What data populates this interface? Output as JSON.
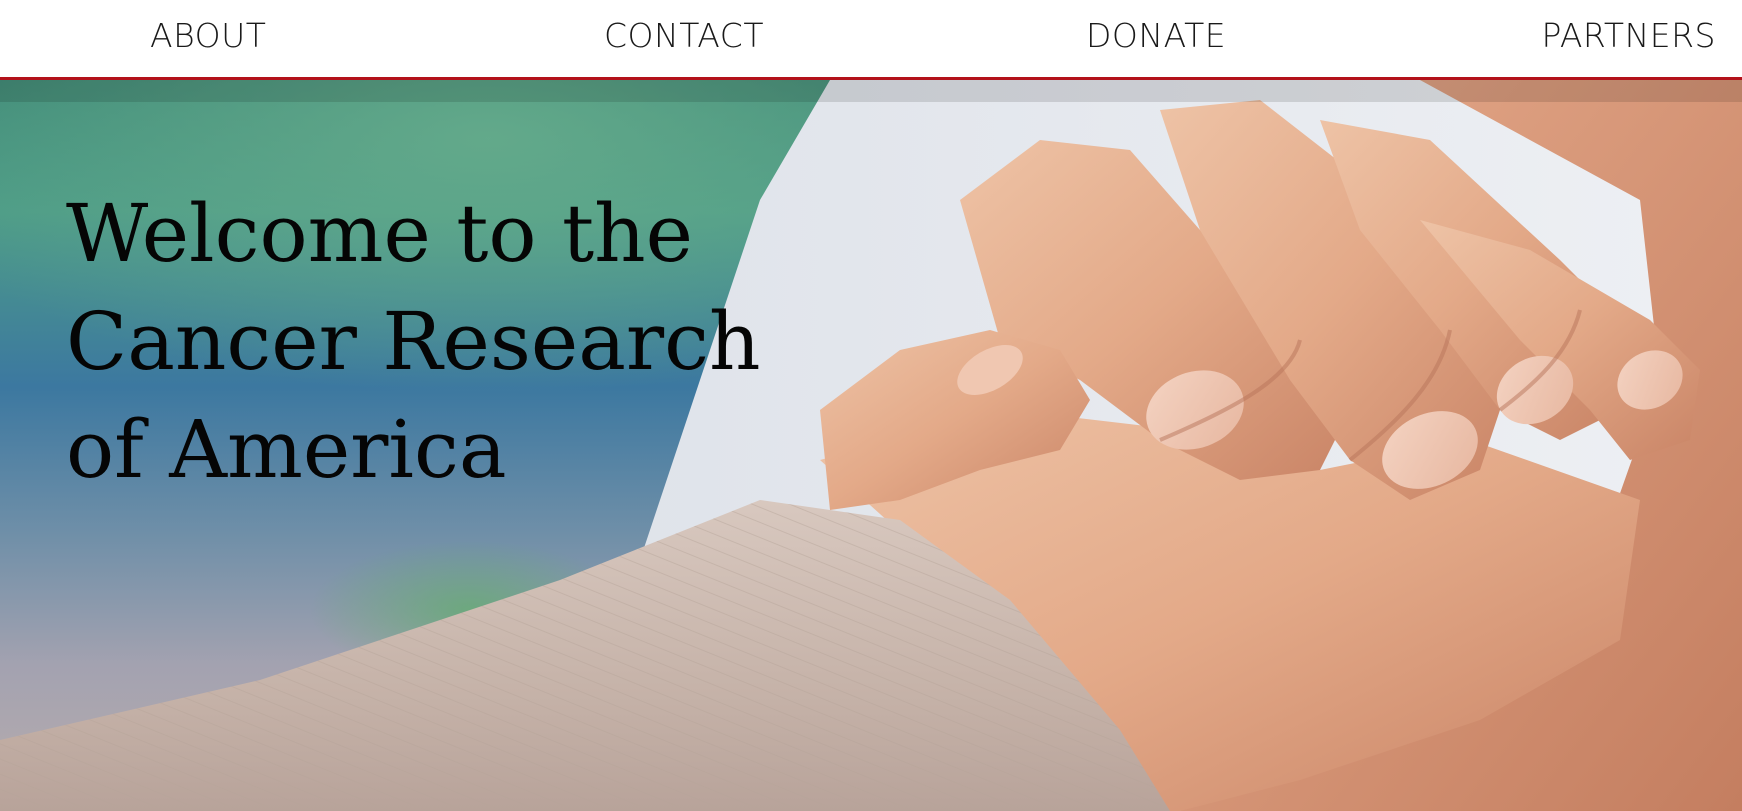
{
  "nav": {
    "items": [
      {
        "label": "ABOUT"
      },
      {
        "label": "CONTACT"
      },
      {
        "label": "DONATE"
      },
      {
        "label": "PARTNERS"
      }
    ],
    "accent_color": "#b3121a"
  },
  "hero": {
    "title_lines": [
      "Welcome to the",
      "Cancer Research",
      "of America"
    ],
    "image_description_icon": "holding-hands-photo",
    "colors": {
      "background_teal": "#4e9a86",
      "background_blue": "#3d78a4",
      "skin": "#e0a587",
      "sleeve": "#c9b7ad"
    }
  }
}
